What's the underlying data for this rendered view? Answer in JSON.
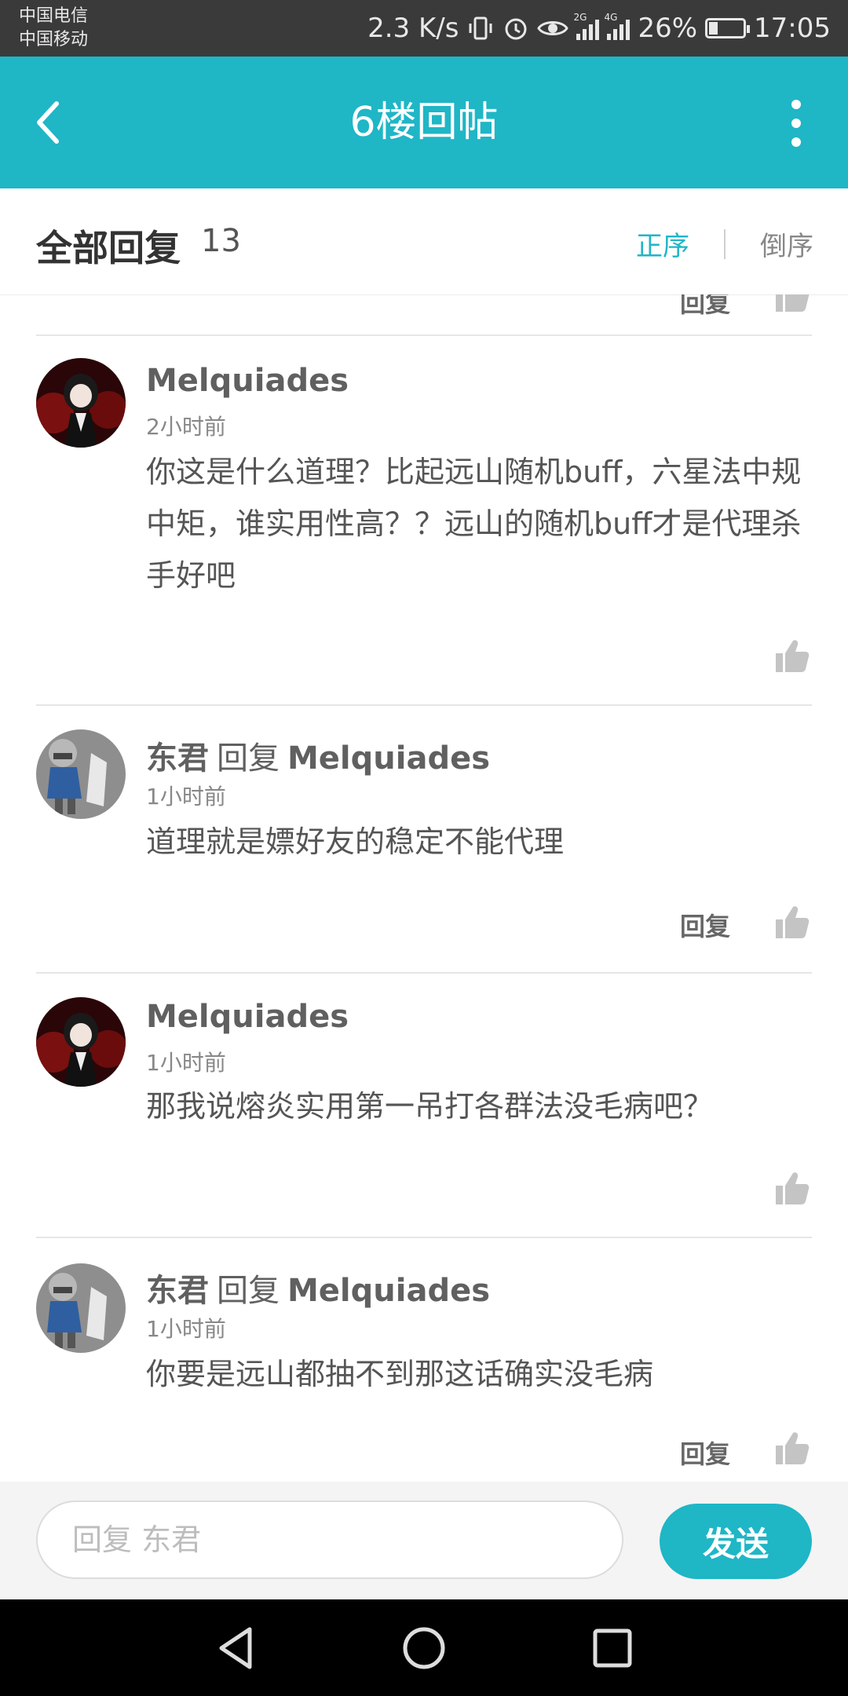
{
  "status_bar": {
    "carrier1": "中国电信",
    "carrier2": "中国移动",
    "speed": "2.3 K/s",
    "sig1_tag": "2G",
    "sig2_tag": "4G",
    "battery_percent": "26%",
    "battery_level": 0.26,
    "time": "17:05"
  },
  "app_bar": {
    "title": "6楼回帖"
  },
  "header": {
    "title": "全部回复",
    "count": "13",
    "sort_asc": "正序",
    "sort_desc": "倒序",
    "active_sort": "正序"
  },
  "replies": [
    {
      "author": "Melquiades",
      "reply_word": "",
      "reply_to": "",
      "time": "2小时前",
      "content": "你这是什么道理？比起远山随机buff，六星法中规中矩，谁实用性高？？远山的随机buff才是代理杀手好吧",
      "reply_label": "",
      "avatar": "dark-anime-avatar"
    },
    {
      "author": "东君",
      "reply_word": "回复",
      "reply_to": "Melquiades",
      "time": "1小时前",
      "content": "道理就是嫖好友的稳定不能代理",
      "reply_label": "回复",
      "avatar": "knight-avatar"
    },
    {
      "author": "Melquiades",
      "reply_word": "",
      "reply_to": "",
      "time": "1小时前",
      "content": "那我说熔炎实用第一吊打各群法没毛病吧？",
      "reply_label": "",
      "avatar": "dark-anime-avatar"
    },
    {
      "author": "东君",
      "reply_word": "回复",
      "reply_to": "Melquiades",
      "time": "1小时前",
      "content": "你要是远山都抽不到那这话确实没毛病",
      "reply_label": "回复",
      "avatar": "knight-avatar"
    }
  ],
  "partial_top_reply_label": "回复",
  "input": {
    "placeholder": "回复 东君",
    "value": "",
    "send_label": "发送"
  },
  "colors": {
    "accent": "#1fb6c6",
    "status_bar": "#3a3a3a",
    "nav_bar": "#000000"
  },
  "icons": {
    "back": "back-arrow-icon",
    "more": "more-vertical-icon",
    "like": "thumbs-up-icon",
    "nav_back": "triangle-back-icon",
    "nav_home": "circle-home-icon",
    "nav_recent": "square-recent-icon"
  }
}
